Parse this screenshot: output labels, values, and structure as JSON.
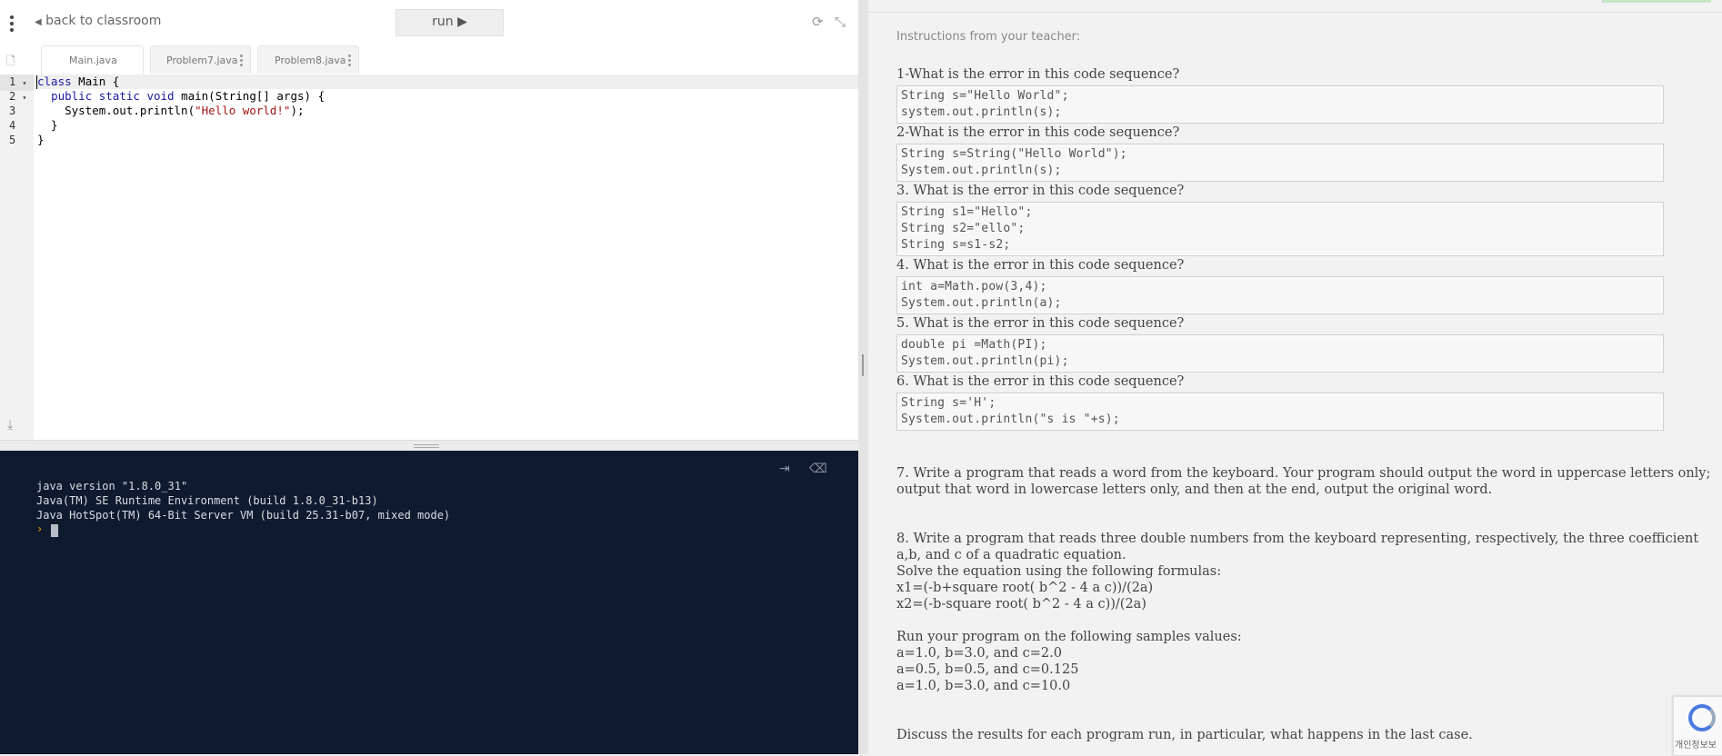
{
  "toolbar": {
    "back_label": "back to classroom",
    "run_label": "run",
    "run_icon": "▶"
  },
  "tabs": [
    {
      "label": "Main.java"
    },
    {
      "label": "Problem7.java"
    },
    {
      "label": "Problem8.java"
    }
  ],
  "editor": {
    "line_numbers": [
      "1",
      "2",
      "3",
      "4",
      "5"
    ]
  },
  "terminal": {
    "lines": [
      "java version \"1.8.0_31\"",
      "Java(TM) SE Runtime Environment (build 1.8.0_31-b13)",
      "Java HotSpot(TM) 64-Bit Server VM (build 25.31-b07, mixed mode)"
    ],
    "prompt": "›"
  },
  "instructions": {
    "header": "Instructions from your teacher:",
    "questions": [
      {
        "title": "1-What is the error in this code sequence?",
        "code": [
          "String s=\"Hello World\";",
          "system.out.println(s);"
        ]
      },
      {
        "title": "2-What is the error in this code sequence?",
        "code": [
          "String s=String(\"Hello World\");",
          "System.out.println(s);"
        ]
      },
      {
        "title": "3. What is the error in this code sequence?",
        "code": [
          "String s1=\"Hello\";",
          "String s2=\"ello\";",
          "String s=s1-s2;"
        ]
      },
      {
        "title": "4. What is the error in this code sequence?",
        "code": [
          "int a=Math.pow(3,4);",
          "System.out.println(a);"
        ]
      },
      {
        "title": "5. What is the error in this code sequence?",
        "code": [
          "double pi =Math(PI);",
          "System.out.println(pi);"
        ]
      },
      {
        "title": "6. What is the error in this code sequence?",
        "code": [
          "String s='H';",
          "System.out.println(\"s is \"+s);"
        ]
      }
    ],
    "q7": [
      "7. Write a program that reads a word from the keyboard. Your program should output the word in uppercase letters only;",
      "output that word in lowercase letters only, and then at the end, output the original word."
    ],
    "q8": [
      "8. Write a program that reads three double numbers from the keyboard representing, respectively, the three coefficient",
      "a,b, and c of a quadratic equation.",
      "Solve the equation using the following formulas:",
      "x1=(-b+square root( b^2 - 4 a c))/(2a)",
      "x2=(-b-square root( b^2 - 4 a c))/(2a)"
    ],
    "samples": [
      "Run your program on the following samples values:",
      "a=1.0, b=3.0, and c=2.0",
      "a=0.5, b=0.5, and c=0.125",
      "a=1.0, b=3.0, and c=10.0"
    ],
    "discuss": "Discuss the results for each program run, in particular, what happens in the last case."
  },
  "recaptcha": {
    "label": "개인정보보"
  }
}
